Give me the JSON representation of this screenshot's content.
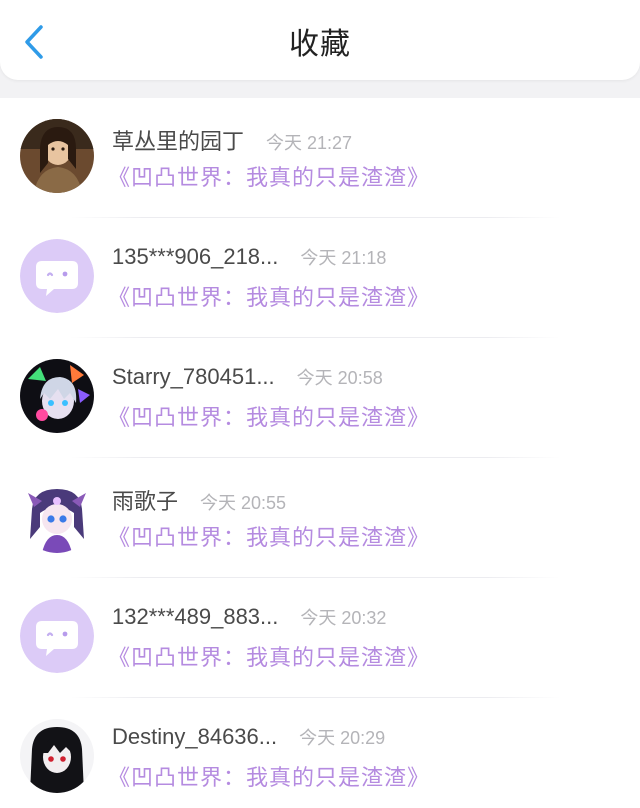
{
  "header": {
    "title": "收藏",
    "back_icon": "chevron-left-icon",
    "accent_color": "#2f9be8"
  },
  "colors": {
    "book_title": "#b58be0",
    "default_avatar_bg": "#dccbf7"
  },
  "favorites": [
    {
      "user": "草丛里的园丁",
      "time": "今天 21:27",
      "book": "《凹凸世界：我真的只是渣渣》",
      "avatar": "portrait-avatar"
    },
    {
      "user": "135***906_218...",
      "time": "今天 21:18",
      "book": "《凹凸世界：我真的只是渣渣》",
      "avatar": "default-chat-avatar"
    },
    {
      "user": "Starry_780451...",
      "time": "今天 20:58",
      "book": "《凹凸世界：我真的只是渣渣》",
      "avatar": "anime-avatar"
    },
    {
      "user": "雨歌子",
      "time": "今天 20:55",
      "book": "《凹凸世界：我真的只是渣渣》",
      "avatar": "anime-girl-avatar"
    },
    {
      "user": "132***489_883...",
      "time": "今天 20:32",
      "book": "《凹凸世界：我真的只是渣渣》",
      "avatar": "default-chat-avatar"
    },
    {
      "user": "Destiny_84636...",
      "time": "今天 20:29",
      "book": "《凹凸世界：我真的只是渣渣》",
      "avatar": "dark-anime-avatar"
    }
  ]
}
